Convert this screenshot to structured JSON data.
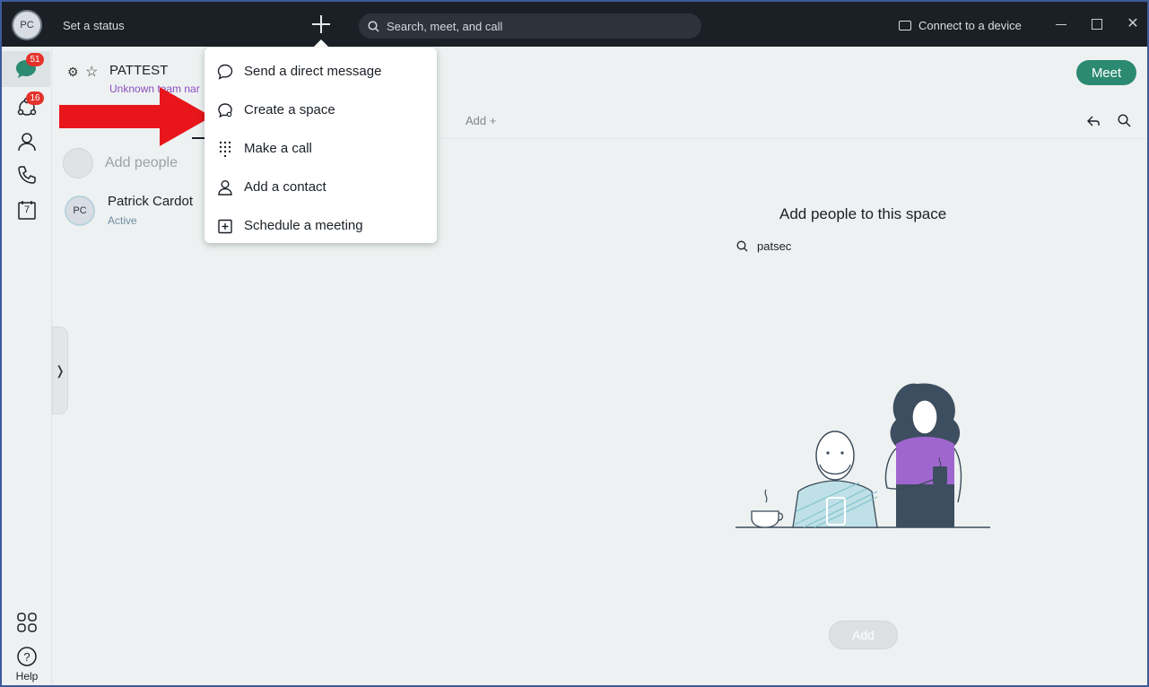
{
  "titlebar": {
    "avatar_initials": "PC",
    "status_label": "Set a status",
    "search_placeholder": "Search, meet, and call",
    "connect_label": "Connect to a device"
  },
  "rail": {
    "messages_badge": "51",
    "teams_badge": "16",
    "calendar_day": "7",
    "help_label": "Help"
  },
  "space": {
    "title": "PATTEST",
    "team_name": "Unknown team nar",
    "add_people_label": "Add people",
    "member": {
      "initials": "PC",
      "name": "Patrick Cardot",
      "status": "Active"
    }
  },
  "menu": {
    "items": [
      {
        "label": "Send a direct message",
        "icon": "chat-bubble-icon"
      },
      {
        "label": "Create a space",
        "icon": "create-space-icon"
      },
      {
        "label": "Make a call",
        "icon": "dialpad-icon"
      },
      {
        "label": "Add a contact",
        "icon": "person-icon"
      },
      {
        "label": "Schedule a meeting",
        "icon": "calendar-plus-icon"
      }
    ]
  },
  "main": {
    "meet_label": "Meet",
    "add_tab_label": "Add +",
    "add_people_title": "Add people to this space",
    "search_value": "patsec",
    "add_button_label": "Add"
  },
  "colors": {
    "titlebar_bg": "#1b2027",
    "meet_green": "#2b8a71",
    "badge_red": "#e4322b",
    "arrow_red": "#e8161b",
    "team_purple": "#8a4fc1"
  }
}
